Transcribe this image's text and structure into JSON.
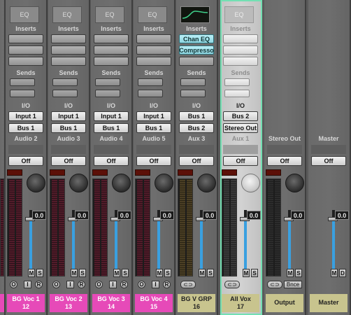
{
  "section_labels": {
    "eq": "EQ",
    "inserts": "Inserts",
    "sends": "Sends",
    "io": "I/O"
  },
  "colors": {
    "pink_tag": "#e64ab8",
    "olive_tag": "#c8c48e",
    "selection_outline": "#73e0b3",
    "fader_blue": "#3aa0e0"
  },
  "strips": [
    {
      "name": "",
      "input": "",
      "output": "",
      "automation": "Off",
      "gain": "0.0",
      "tag": "",
      "tag2": ""
    },
    {
      "name": "Audio 2",
      "input": "Input 1",
      "output": "Bus 1",
      "automation": "Off",
      "gain": "0.0",
      "tag": "BG Voc 1",
      "tag2": "12"
    },
    {
      "name": "Audio 3",
      "input": "Input 1",
      "output": "Bus 1",
      "automation": "Off",
      "gain": "0.0",
      "tag": "BG Voc 2",
      "tag2": "13"
    },
    {
      "name": "Audio 4",
      "input": "Input 1",
      "output": "Bus 1",
      "automation": "Off",
      "gain": "0.0",
      "tag": "BG Voc 3",
      "tag2": "14"
    },
    {
      "name": "Audio 5",
      "input": "Input 1",
      "output": "Bus 1",
      "automation": "Off",
      "gain": "0.0",
      "tag": "BG Voc 4",
      "tag2": "15"
    },
    {
      "name": "Aux 3",
      "input": "Bus 1",
      "output": "Bus 2",
      "automation": "Off",
      "gain": "0.0",
      "tag": "BG V GRP",
      "tag2": "16",
      "plugins": [
        "Chan EQ",
        "Compresso"
      ]
    },
    {
      "name": "Aux 1",
      "input": "Bus 2",
      "output": "Stereo Out",
      "automation": "Off",
      "gain": "0.0",
      "tag": "All Vox",
      "tag2": "17"
    },
    {
      "name": "Stereo Out",
      "automation": "Off",
      "gain": "0.0",
      "tag": "Output"
    },
    {
      "name": "Master",
      "automation": "Off",
      "gain": "0.0",
      "tag": "Master"
    }
  ],
  "buttons": {
    "mute": "M",
    "solo": "S",
    "input_monitor": "I",
    "record": "R",
    "dim": "D",
    "bounce": "Bnce",
    "off": "O"
  }
}
